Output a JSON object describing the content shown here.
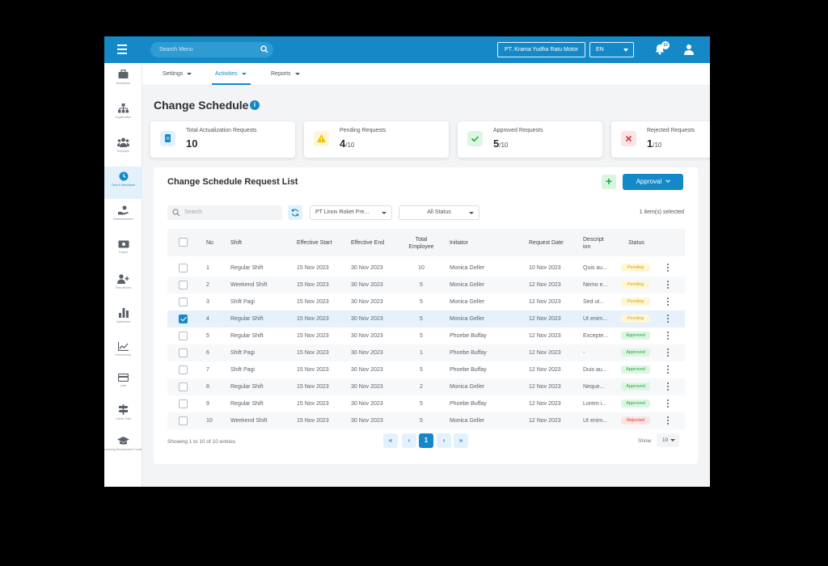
{
  "topbar": {
    "search_placeholder": "Search Menu",
    "company": "PT. Krama Yudha Ratu Motor",
    "language": "EN",
    "notification_count": "10"
  },
  "sidebar": {
    "items": [
      {
        "label": "Workbench",
        "icon": "briefcase-icon"
      },
      {
        "label": "Organization",
        "icon": "org-chart-icon"
      },
      {
        "label": "Employee",
        "icon": "people-icon"
      },
      {
        "label": "Time & Attendance",
        "icon": "clock-icon"
      },
      {
        "label": "Reimbursement",
        "icon": "hand-money-icon"
      },
      {
        "label": "Payroll",
        "icon": "cash-icon"
      },
      {
        "label": "Recruitment",
        "icon": "add-user-icon"
      },
      {
        "label": "Dashboard",
        "icon": "bar-chart-icon"
      },
      {
        "label": "Performance",
        "icon": "trend-icon"
      },
      {
        "label": "Loan",
        "icon": "card-icon"
      },
      {
        "label": "Career Path",
        "icon": "signpost-icon"
      },
      {
        "label": "Learning Development Center",
        "icon": "graduation-cap-icon"
      }
    ]
  },
  "subnav": {
    "tabs": [
      {
        "label": "Settings"
      },
      {
        "label": "Activities"
      },
      {
        "label": "Reports"
      }
    ]
  },
  "page": {
    "title": "Change Schedule"
  },
  "stats": [
    {
      "title": "Total Actualization Requests",
      "value": "10",
      "total": ""
    },
    {
      "title": "Pending Requests",
      "value": "4",
      "total": "/10"
    },
    {
      "title": "Approved Requests",
      "value": "5",
      "total": "/10"
    },
    {
      "title": "Rejected Requests",
      "value": "1",
      "total": "/10"
    }
  ],
  "list": {
    "title": "Change Schedule Request List",
    "approval_label": "Approval",
    "search_placeholder": "Search",
    "company_filter": "PT Linov Roket Pre...",
    "status_filter": "All Status",
    "selected_count": "1 item(s) selected",
    "headers": {
      "no": "No",
      "shift": "Shift",
      "effective_start": "Effective Start",
      "effective_end": "Effective End",
      "total_employee": "Total Employee",
      "initiator": "Initiator",
      "request_date": "Request Date",
      "description": "Descript ion",
      "status": "Status"
    },
    "rows": [
      {
        "no": "1",
        "shift": "Regular Shift",
        "start": "15 Nov 2023",
        "end": "30 Nov 2023",
        "total": "10",
        "initiator": "Monica Geller",
        "request_date": "10 Nov 2023",
        "desc": "Quis au...",
        "status": "Pending",
        "checked": false
      },
      {
        "no": "2",
        "shift": "Weekend Shift",
        "start": "15 Nov 2023",
        "end": "30 Nov 2023",
        "total": "5",
        "initiator": "Monica Geller",
        "request_date": "12 Nov 2023",
        "desc": "Nemo e...",
        "status": "Pending",
        "checked": false
      },
      {
        "no": "3",
        "shift": "Shift Pagi",
        "start": "15 Nov 2023",
        "end": "30 Nov 2023",
        "total": "5",
        "initiator": "Monica Geller",
        "request_date": "12 Nov 2023",
        "desc": "Sed ut...",
        "status": "Pending",
        "checked": false
      },
      {
        "no": "4",
        "shift": "Regular Shift",
        "start": "15 Nov 2023",
        "end": "30 Nov 2023",
        "total": "5",
        "initiator": "Monica Geller",
        "request_date": "12 Nov 2023",
        "desc": "Ut enim...",
        "status": "Pending",
        "checked": true
      },
      {
        "no": "5",
        "shift": "Regular Shift",
        "start": "15 Nov 2023",
        "end": "30 Nov 2023",
        "total": "5",
        "initiator": "Phoebe Buffay",
        "request_date": "12 Nov 2023",
        "desc": "Excepte...",
        "status": "Approved",
        "checked": false
      },
      {
        "no": "6",
        "shift": "Shift Pagi",
        "start": "15 Nov 2023",
        "end": "30 Nov 2023",
        "total": "1",
        "initiator": "Phoebe Buffay",
        "request_date": "12 Nov 2023",
        "desc": "-",
        "status": "Approved",
        "checked": false
      },
      {
        "no": "7",
        "shift": "Shift Pagi",
        "start": "15 Nov 2023",
        "end": "30 Nov 2023",
        "total": "5",
        "initiator": "Phoebe Buffay",
        "request_date": "12 Nov 2023",
        "desc": "Duis au...",
        "status": "Approved",
        "checked": false
      },
      {
        "no": "8",
        "shift": "Regular Shift",
        "start": "15 Nov 2023",
        "end": "30 Nov 2023",
        "total": "2",
        "initiator": "Monica Geller",
        "request_date": "12 Nov 2023",
        "desc": "Neque...",
        "status": "Approved",
        "checked": false
      },
      {
        "no": "9",
        "shift": "Regular Shift",
        "start": "15 Nov 2023",
        "end": "30 Nov 2023",
        "total": "5",
        "initiator": "Phoebe Buffay",
        "request_date": "12 Nov 2023",
        "desc": "Lorem i...",
        "status": "Approved",
        "checked": false
      },
      {
        "no": "10",
        "shift": "Weekend Shift",
        "start": "15 Nov 2023",
        "end": "30 Nov 2023",
        "total": "5",
        "initiator": "Monica Geller",
        "request_date": "12 Nov 2023",
        "desc": "Ut enim...",
        "status": "Rejected",
        "checked": false
      }
    ],
    "showing": "Showing 1 to 10 of 10 entries",
    "pagination": {
      "first": "«",
      "prev": "‹",
      "current": "1",
      "next": "›",
      "last": "»"
    },
    "show_label": "Show",
    "page_size": "10"
  },
  "colors": {
    "primary": "#1589c8",
    "pending": "#d6a200",
    "approved": "#23a443",
    "rejected": "#e03131"
  }
}
